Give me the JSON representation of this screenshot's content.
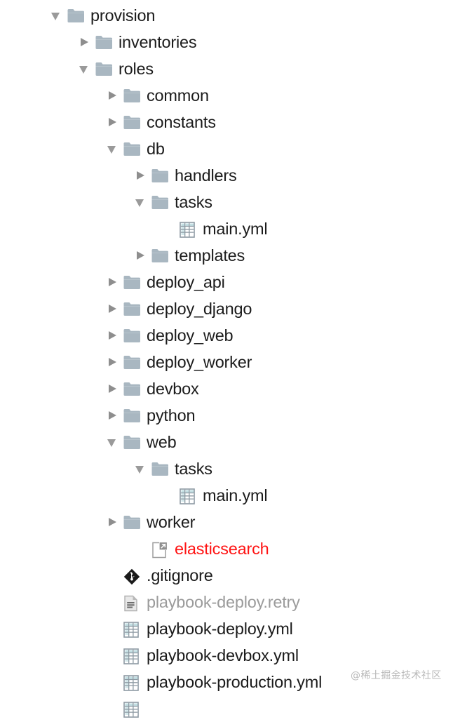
{
  "tree": {
    "root_name": "provision",
    "colors": {
      "folder": "#a9b7c1",
      "twisty": "#919191",
      "text": "#1b1b1b",
      "text_muted": "#9b9b9b",
      "symlink_text": "#ff1414",
      "yml_accent": "#6fb3bd",
      "background": "#ffffff"
    },
    "items": [
      {
        "label": "provision",
        "depth": 0,
        "icon": "folder-icon",
        "state": "expanded",
        "style": "normal"
      },
      {
        "label": "inventories",
        "depth": 1,
        "icon": "folder-icon",
        "state": "collapsed",
        "style": "normal"
      },
      {
        "label": "roles",
        "depth": 1,
        "icon": "folder-icon",
        "state": "expanded",
        "style": "normal"
      },
      {
        "label": "common",
        "depth": 2,
        "icon": "folder-icon",
        "state": "collapsed",
        "style": "normal"
      },
      {
        "label": "constants",
        "depth": 2,
        "icon": "folder-icon",
        "state": "collapsed",
        "style": "normal"
      },
      {
        "label": "db",
        "depth": 2,
        "icon": "folder-icon",
        "state": "expanded",
        "style": "normal"
      },
      {
        "label": "handlers",
        "depth": 3,
        "icon": "folder-icon",
        "state": "collapsed",
        "style": "normal"
      },
      {
        "label": "tasks",
        "depth": 3,
        "icon": "folder-icon",
        "state": "expanded",
        "style": "normal"
      },
      {
        "label": "main.yml",
        "depth": 4,
        "icon": "yml-file-icon",
        "state": "leaf",
        "style": "normal"
      },
      {
        "label": "templates",
        "depth": 3,
        "icon": "folder-icon",
        "state": "collapsed",
        "style": "normal"
      },
      {
        "label": "deploy_api",
        "depth": 2,
        "icon": "folder-icon",
        "state": "collapsed",
        "style": "normal"
      },
      {
        "label": "deploy_django",
        "depth": 2,
        "icon": "folder-icon",
        "state": "collapsed",
        "style": "normal"
      },
      {
        "label": "deploy_web",
        "depth": 2,
        "icon": "folder-icon",
        "state": "collapsed",
        "style": "normal"
      },
      {
        "label": "deploy_worker",
        "depth": 2,
        "icon": "folder-icon",
        "state": "collapsed",
        "style": "normal"
      },
      {
        "label": "devbox",
        "depth": 2,
        "icon": "folder-icon",
        "state": "collapsed",
        "style": "normal"
      },
      {
        "label": "python",
        "depth": 2,
        "icon": "folder-icon",
        "state": "collapsed",
        "style": "normal"
      },
      {
        "label": "web",
        "depth": 2,
        "icon": "folder-icon",
        "state": "expanded",
        "style": "normal"
      },
      {
        "label": "tasks",
        "depth": 3,
        "icon": "folder-icon",
        "state": "expanded",
        "style": "normal"
      },
      {
        "label": "main.yml",
        "depth": 4,
        "icon": "yml-file-icon",
        "state": "leaf",
        "style": "normal"
      },
      {
        "label": "worker",
        "depth": 2,
        "icon": "folder-icon",
        "state": "collapsed",
        "style": "normal"
      },
      {
        "label": "elasticsearch",
        "depth": 3,
        "icon": "symlink-file-icon",
        "state": "leaf",
        "style": "symlink"
      },
      {
        "label": ".gitignore",
        "depth": 2,
        "icon": "git-file-icon",
        "state": "leaf",
        "style": "normal"
      },
      {
        "label": "playbook-deploy.retry",
        "depth": 2,
        "icon": "text-file-icon",
        "state": "leaf",
        "style": "muted"
      },
      {
        "label": "playbook-deploy.yml",
        "depth": 2,
        "icon": "yml-file-icon",
        "state": "leaf",
        "style": "normal"
      },
      {
        "label": "playbook-devbox.yml",
        "depth": 2,
        "icon": "yml-file-icon",
        "state": "leaf",
        "style": "normal"
      },
      {
        "label": "playbook-production.yml",
        "depth": 2,
        "icon": "yml-file-icon",
        "state": "leaf",
        "style": "normal"
      },
      {
        "label": "",
        "depth": 2,
        "icon": "yml-file-icon",
        "state": "leaf",
        "style": "normal"
      }
    ]
  },
  "watermark": {
    "text": "@稀土掘金技术社区"
  }
}
